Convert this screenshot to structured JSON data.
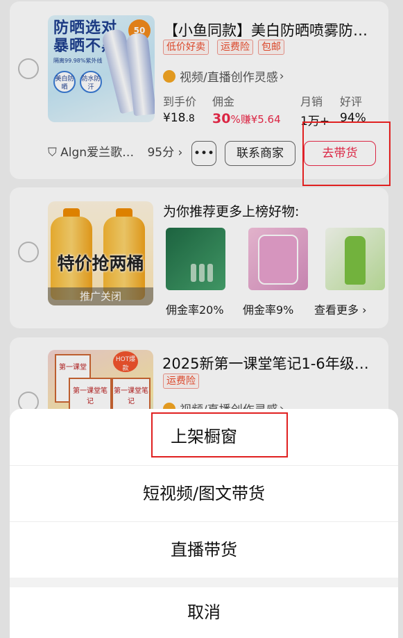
{
  "product1": {
    "thumb_headline_1": "防晒选对",
    "thumb_headline_2": "暴晒不黑",
    "thumb_badge": "50",
    "thumb_small": "隔离99.98%紫外线",
    "thumb_dot_1": "美白防晒",
    "thumb_dot_2": "防水防汗",
    "title": "【小鱼同款】美白防晒喷雾防…",
    "tags": [
      "低价好卖",
      "运费险",
      "包邮"
    ],
    "inspire": "视频/直播创作灵感",
    "inspire_arrow": "›",
    "labels": {
      "price": "到手价",
      "commission": "佣金",
      "monthly_sales": "月销",
      "rating": "好评"
    },
    "values": {
      "price_symbol": "¥",
      "price_int": "18",
      "price_dec": ".8",
      "commission_rate": "30",
      "commission_unit": "%赚¥5.64",
      "monthly_sales": "1万+",
      "rating": "94%"
    },
    "shop_name": "Algn爱兰歌…",
    "shop_score": "95分",
    "shop_arrow": "›",
    "more_label": "•••",
    "contact_label": "联系商家",
    "promote_label": "去带货"
  },
  "product2": {
    "thumb_text": "特价抢两桶",
    "ad_close": "推广关闭",
    "rec_title": "为你推荐更多上榜好物:",
    "rates": [
      "佣金率20%",
      "佣金率9%"
    ],
    "see_more": "查看更多",
    "see_more_arrow": "›"
  },
  "product3": {
    "thumb_book_1": "第一课堂",
    "thumb_book_2": "第一课堂笔记",
    "thumb_hot": "HOT爆款",
    "title": "2025新第一课堂笔记1-6年级…",
    "tags": [
      "运费险"
    ],
    "inspire": "视频/直播创作灵感",
    "inspire_arrow": "›"
  },
  "action_sheet": {
    "option1": "上架橱窗",
    "option2": "短视频/图文带货",
    "option3": "直播带货",
    "cancel": "取消"
  }
}
